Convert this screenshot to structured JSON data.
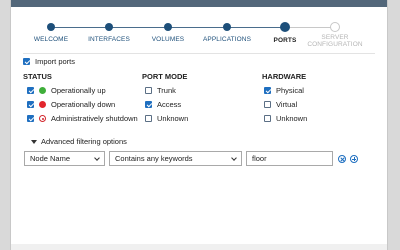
{
  "wizard": {
    "steps": [
      {
        "label": "WELCOME"
      },
      {
        "label": "INTERFACES"
      },
      {
        "label": "VOLUMES"
      },
      {
        "label": "APPLICATIONS"
      },
      {
        "label": "PORTS"
      },
      {
        "label_line1": "SERVER",
        "label_line2": "CONFIGURATION"
      }
    ],
    "current_step": "PORTS"
  },
  "import_ports": {
    "label": "Import ports",
    "checked": true
  },
  "status": {
    "heading": "STATUS",
    "items": [
      {
        "label": "Operationally up",
        "checked": true,
        "icon": "status-up-icon"
      },
      {
        "label": "Operationally down",
        "checked": true,
        "icon": "status-down-icon"
      },
      {
        "label": "Administratively shutdown",
        "checked": true,
        "icon": "status-shutdown-icon"
      }
    ]
  },
  "port_mode": {
    "heading": "PORT MODE",
    "items": [
      {
        "label": "Trunk",
        "checked": false
      },
      {
        "label": "Access",
        "checked": true
      },
      {
        "label": "Unknown",
        "checked": false
      }
    ]
  },
  "hardware": {
    "heading": "HARDWARE",
    "items": [
      {
        "label": "Physical",
        "checked": true
      },
      {
        "label": "Virtual",
        "checked": false
      },
      {
        "label": "Unknown",
        "checked": false
      }
    ]
  },
  "advanced": {
    "label": "Advanced filtering options",
    "field_select": "Node Name",
    "operator_select": "Contains any keywords",
    "value": "floor"
  },
  "colors": {
    "header_band": "#53677a",
    "accent_blue": "#1f6fc0",
    "step_blue": "#1d4f7a",
    "status_up": "#3fae3a",
    "status_down": "#e2262d"
  }
}
